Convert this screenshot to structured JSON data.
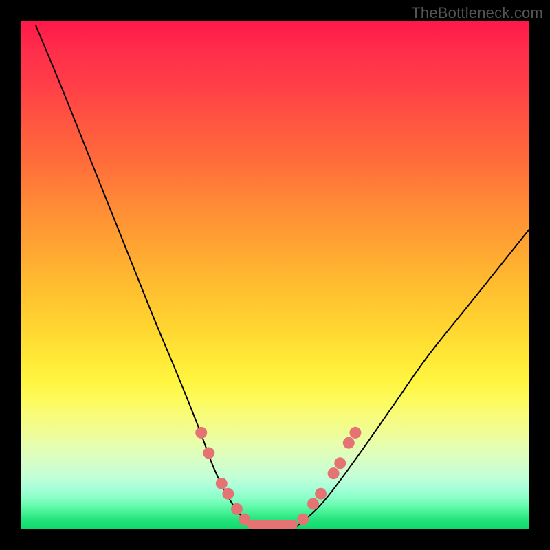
{
  "attribution": "TheBottleneck.com",
  "chart_data": {
    "type": "line",
    "title": "",
    "xlabel": "",
    "ylabel": "",
    "xlim": [
      0,
      100
    ],
    "ylim": [
      0,
      100
    ],
    "note": "Unlabeled V-shaped bottleneck curve over a vertical color gradient (red = high bottleneck, green = low). Axes have no tick labels. Values below are estimated from the plot.",
    "series": [
      {
        "name": "bottleneck-curve",
        "x": [
          3,
          8,
          14,
          20,
          26,
          31,
          35,
          38,
          41,
          44,
          47,
          50,
          53,
          56,
          60,
          66,
          73,
          80,
          88,
          96,
          100
        ],
        "y": [
          99,
          87,
          72,
          57,
          42,
          30,
          20,
          12,
          6,
          2,
          0,
          0,
          0,
          2,
          6,
          14,
          24,
          34,
          44,
          54,
          59
        ]
      }
    ],
    "markers": {
      "name": "highlighted-points-on-curve",
      "x": [
        35.5,
        37.0,
        39.5,
        40.8,
        42.5,
        44.0,
        55.5,
        57.5,
        59.0,
        61.5,
        62.8,
        64.5,
        65.8
      ],
      "y": [
        19,
        15,
        9,
        7,
        4,
        2,
        2,
        5,
        7,
        11,
        13,
        17,
        19
      ]
    },
    "flat_minimum_segment": {
      "x_start": 45.5,
      "x_end": 53.5,
      "y": 0
    }
  },
  "colors": {
    "marker": "#e57373",
    "curve": "#000000"
  }
}
